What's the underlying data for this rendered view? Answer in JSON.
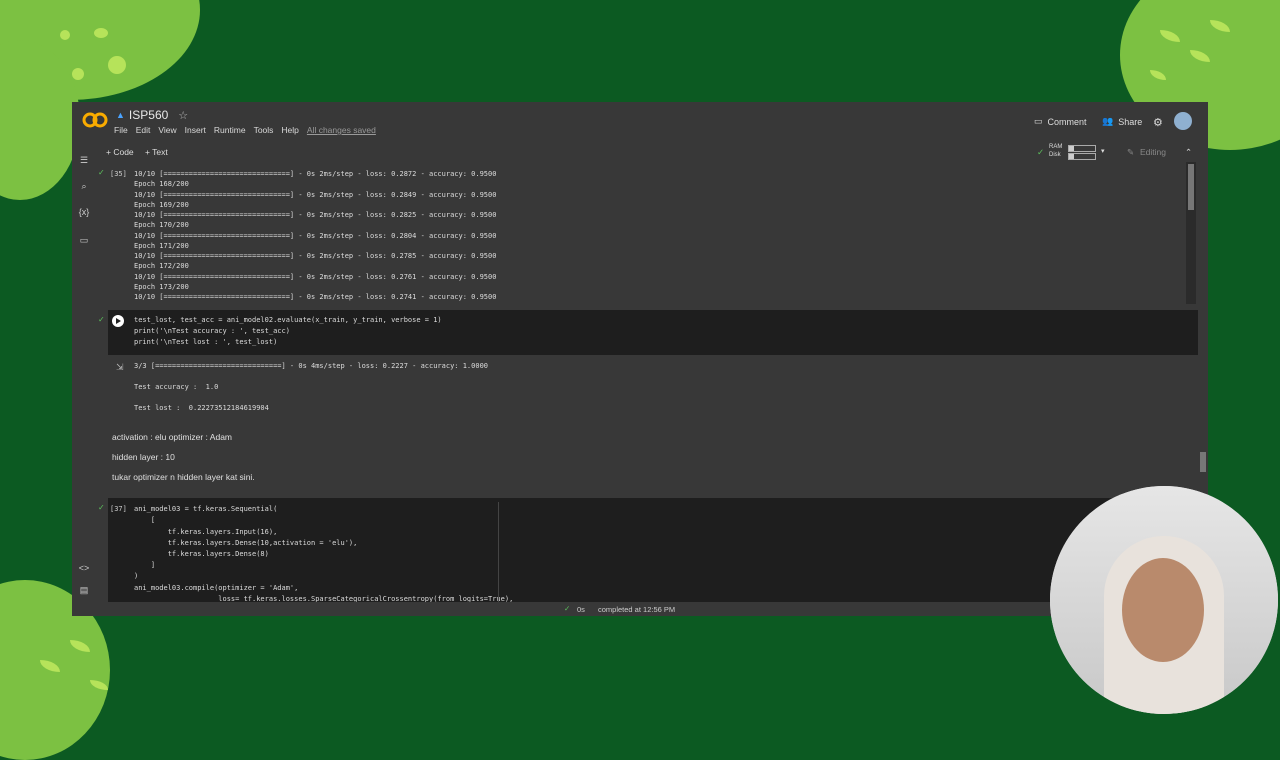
{
  "notebook": {
    "title": "ISP560"
  },
  "menu": [
    "File",
    "Edit",
    "View",
    "Insert",
    "Runtime",
    "Tools",
    "Help"
  ],
  "saved_status": "All changes saved",
  "header_buttons": {
    "comment": "Comment",
    "share": "Share"
  },
  "toolbar": {
    "code": "+ Code",
    "text": "+ Text",
    "ram": "RAM",
    "disk": "Disk",
    "editing": "Editing"
  },
  "cell35": {
    "exec_count": "[35]",
    "lines": [
      "10/10 [==============================] - 0s 2ms/step - loss: 0.2872 - accuracy: 0.9500",
      "Epoch 168/200",
      "10/10 [==============================] - 0s 2ms/step - loss: 0.2849 - accuracy: 0.9500",
      "Epoch 169/200",
      "10/10 [==============================] - 0s 2ms/step - loss: 0.2825 - accuracy: 0.9500",
      "Epoch 170/200",
      "10/10 [==============================] - 0s 2ms/step - loss: 0.2804 - accuracy: 0.9500",
      "Epoch 171/200",
      "10/10 [==============================] - 0s 2ms/step - loss: 0.2785 - accuracy: 0.9500",
      "Epoch 172/200",
      "10/10 [==============================] - 0s 2ms/step - loss: 0.2761 - accuracy: 0.9500",
      "Epoch 173/200",
      "10/10 [==============================] - 0s 2ms/step - loss: 0.2741 - accuracy: 0.9500"
    ]
  },
  "cell_eval": {
    "code": [
      "test_lost, test_acc = ani_model02.evaluate(x_train, y_train, verbose = 1)",
      "print('\\nTest accuracy : ', test_acc)",
      "print('\\nTest lost : ', test_lost)"
    ],
    "output": [
      "3/3 [==============================] - 0s 4ms/step - loss: 0.2227 - accuracy: 1.0000",
      "Test accuracy :  1.0",
      "Test lost :  0.22273512184619904"
    ]
  },
  "markdown": [
    "activation : elu optimizer : Adam",
    "hidden layer : 10",
    "tukar optimizer n hidden layer kat sini."
  ],
  "cell37": {
    "exec_count": "[37]",
    "code": [
      "ani_model03 = tf.keras.Sequential(",
      "    [",
      "        tf.keras.layers.Input(16),",
      "        tf.keras.layers.Dense(10,activation = 'elu'),",
      "        tf.keras.layers.Dense(8)",
      "    ]",
      ")",
      "ani_model03.compile(optimizer = 'Adam',",
      "                    loss= tf.keras.losses.SparseCategoricalCrossentropy(from_logits=True),"
    ]
  },
  "statusbar": {
    "time": "0s",
    "completed": "completed at 12:56 PM"
  },
  "colors": {
    "bg_green": "#0c5a22",
    "leaf_green": "#7cc142",
    "colab_bg": "#383838",
    "code_bg": "#1e1e1e",
    "orange": "#f9ab00"
  },
  "icons": [
    "colab-logo-icon",
    "drive-icon",
    "star-icon",
    "comment-icon",
    "share-icon",
    "gear-icon",
    "avatar-icon",
    "menu-icon",
    "search-icon",
    "variables-icon",
    "folder-icon",
    "code-snippets-icon",
    "terminal-icon",
    "run-icon",
    "output-icon",
    "check-icon",
    "pencil-icon",
    "chevron-up-icon"
  ]
}
